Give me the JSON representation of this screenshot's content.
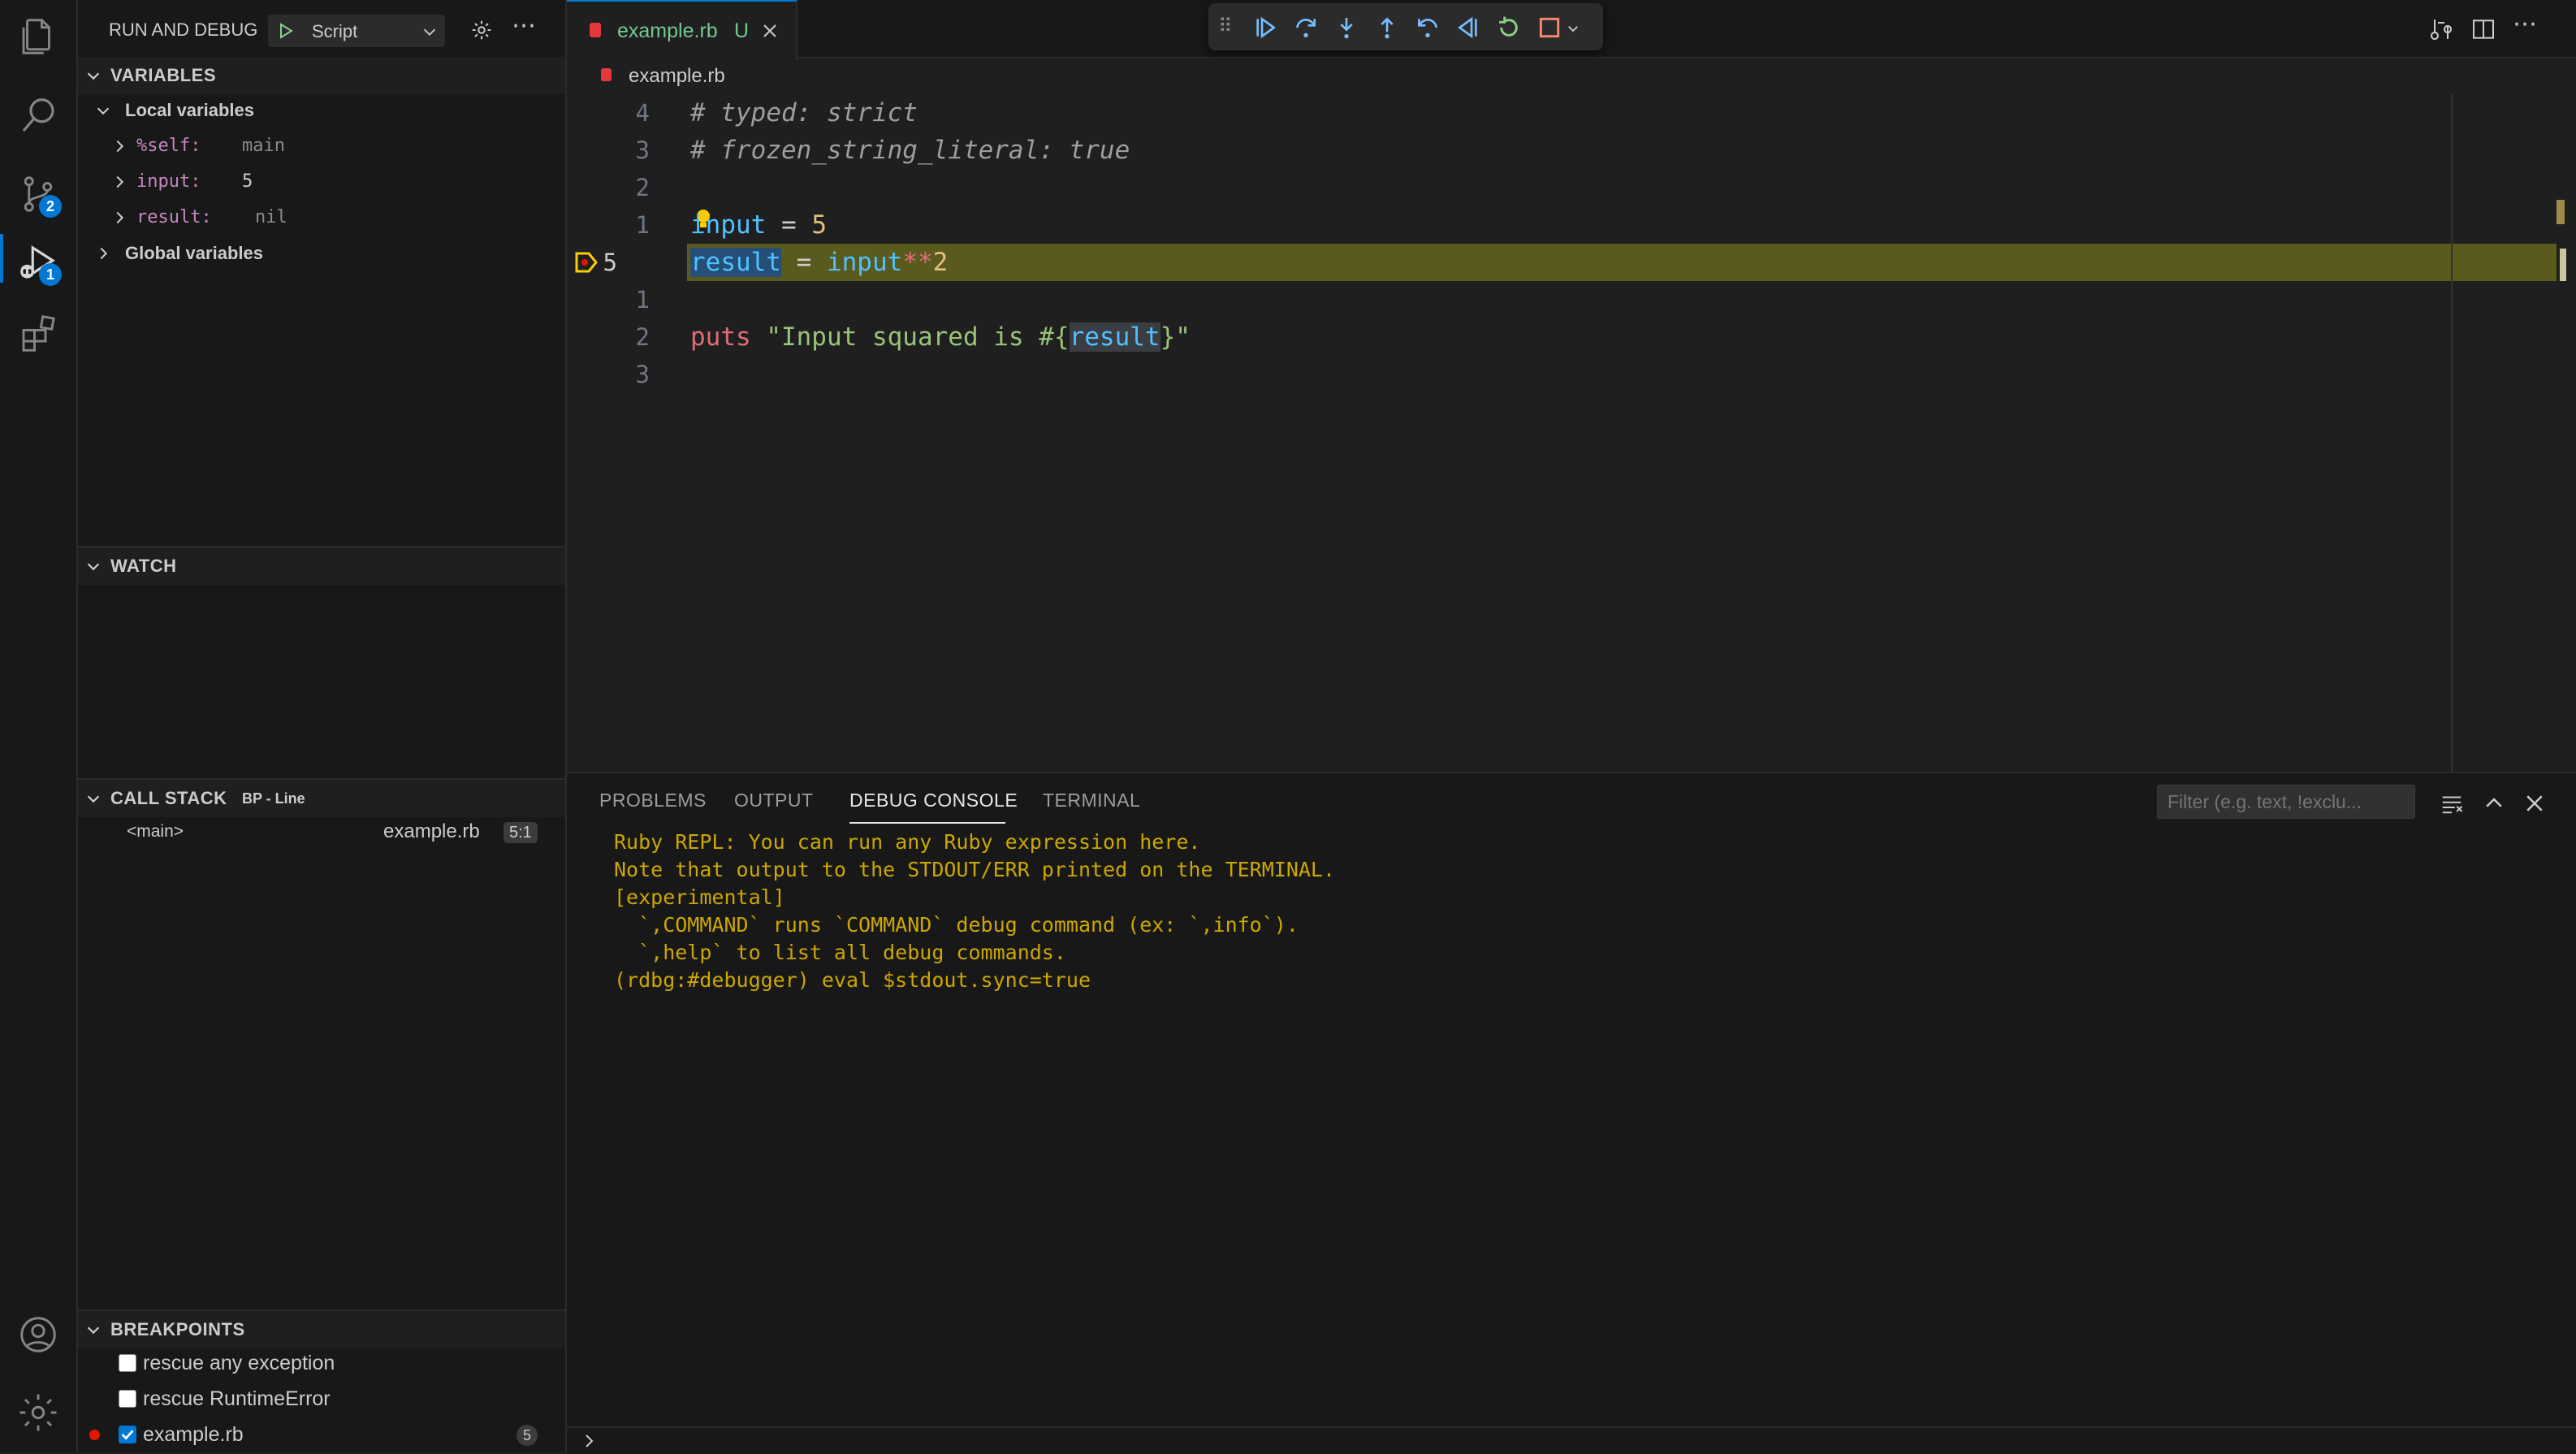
{
  "activity_bar": {
    "scm_badge": "2",
    "debug_badge": "1"
  },
  "sidebar": {
    "title": "RUN AND DEBUG",
    "config_select": "Script",
    "variables": {
      "header": "VARIABLES",
      "local_group": "Local variables",
      "items": [
        {
          "name": "%self:",
          "value": "main"
        },
        {
          "name": "input:",
          "value": "5"
        },
        {
          "name": "result:",
          "value": "nil"
        }
      ],
      "global_group": "Global variables"
    },
    "watch": {
      "header": "WATCH"
    },
    "call_stack": {
      "header": "CALL STACK",
      "badge": "BP - Line",
      "frames": [
        {
          "name": "<main>",
          "file": "example.rb",
          "pos": "5:1"
        }
      ]
    },
    "breakpoints": {
      "header": "BREAKPOINTS",
      "items": [
        {
          "label": "rescue any exception",
          "checked": false
        },
        {
          "label": "rescue RuntimeError",
          "checked": false
        },
        {
          "label": "example.rb",
          "checked": true,
          "count": "5"
        }
      ]
    }
  },
  "editor": {
    "tab_label": "example.rb",
    "tab_status": "U",
    "breadcrumb": "example.rb",
    "line_numbers": [
      "4",
      "3",
      "2",
      "1",
      "5",
      "1",
      "2",
      "3"
    ],
    "code": {
      "line1": "# typed: strict",
      "line2": "# frozen_string_literal: true",
      "line4_var": "input",
      "line4_rest": " = ",
      "line4_num": "5",
      "line5_var": "result",
      "line5_eq": " = ",
      "line5_input": "input",
      "line5_op": "**",
      "line5_num": "2",
      "line7_puts": "puts",
      "line7_str1": " \"Input squared is #{",
      "line7_interp": "result",
      "line7_str2": "}\""
    }
  },
  "panel": {
    "tabs": [
      "PROBLEMS",
      "OUTPUT",
      "DEBUG CONSOLE",
      "TERMINAL"
    ],
    "active_tab": "DEBUG CONSOLE",
    "filter_placeholder": "Filter (e.g. text, !exclu...",
    "console_lines": [
      "Ruby REPL: You can run any Ruby expression here.",
      "Note that output to the STDOUT/ERR printed on the TERMINAL.",
      "[experimental]",
      "  `,COMMAND` runs `COMMAND` debug command (ex: `,info`).",
      "  `,help` to list all debug commands.",
      "(rdbg:#debugger) eval $stdout.sync=true"
    ]
  },
  "colors": {
    "accent": "#0078d4",
    "console_text": "#cca700",
    "highlight_line": "#5a5a1e"
  }
}
